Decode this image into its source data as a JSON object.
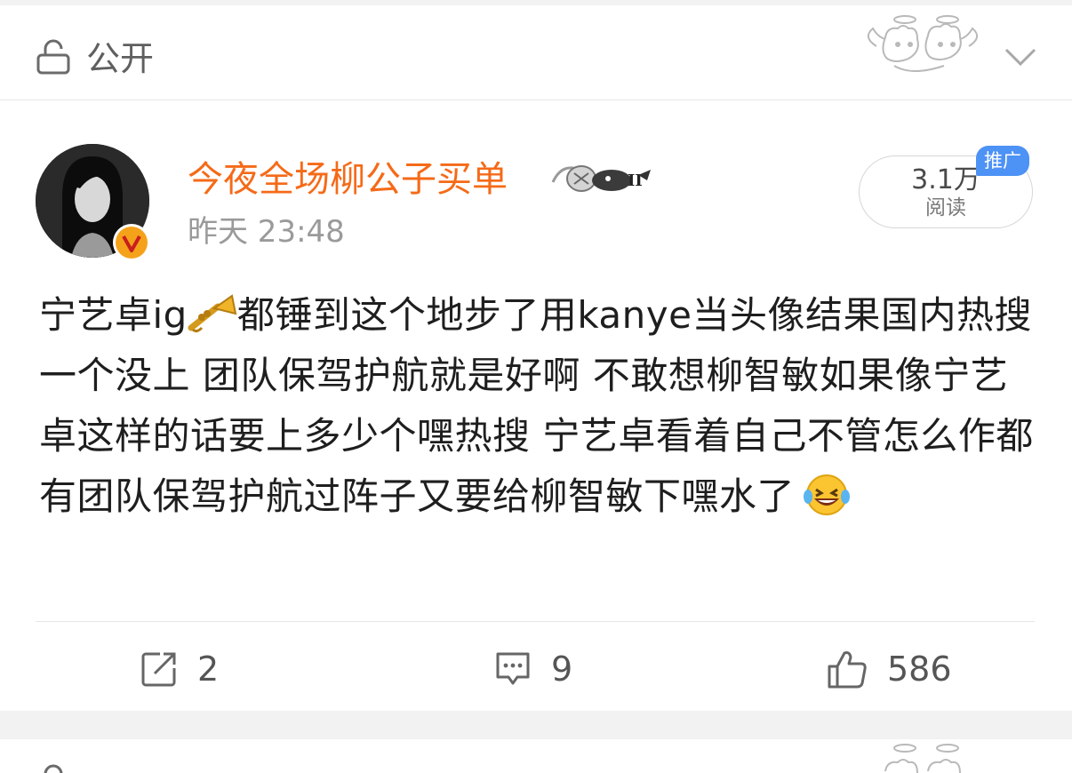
{
  "visibility": {
    "label": "公开",
    "icon": "unlock-icon",
    "expand_icon": "chevron-down-icon"
  },
  "post": {
    "author": "今夜全场柳公子买单",
    "time": "昨天 23:48",
    "verified_icon": "v-verified-badge-icon",
    "reads": {
      "count": "3.1万",
      "label": "阅读"
    },
    "promo_tag": "推广",
    "text_parts": [
      "宁艺卓ig",
      "都锤到这个地步了用kanye当头像结果国内热搜一个没上 团队保驾护航就是好啊 不敢想柳智敏如果像宁艺卓这样的话要上多少个嘿热搜  宁艺卓看着自己不管怎么作都有团队保驾护航过阵子又要给柳智敏下嘿水了"
    ],
    "emojis": [
      "trumpet-emoji",
      "laughing-tears-emoji"
    ],
    "actions": {
      "repost": {
        "icon": "share-icon",
        "count": "2"
      },
      "comment": {
        "icon": "comment-icon",
        "count": "9"
      },
      "like": {
        "icon": "thumbs-up-icon",
        "count": "586"
      }
    }
  },
  "colors": {
    "author_name": "#f56a18",
    "promo_badge": "#4d92f5",
    "background": "#f2f2f2"
  }
}
